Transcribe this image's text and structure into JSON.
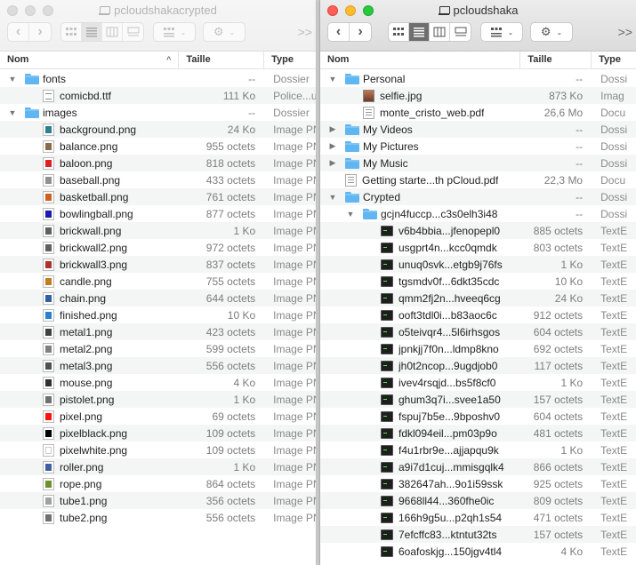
{
  "left_window": {
    "title": "pcloudshakacrypted",
    "columns": {
      "name": "Nom",
      "size": "Taille",
      "type": "Type"
    },
    "rows": [
      {
        "indent": 0,
        "disc": "▼",
        "kind": "folder",
        "name": "fonts",
        "size": "--",
        "type": "Dossier"
      },
      {
        "indent": 1,
        "disc": "",
        "kind": "ttf",
        "name": "comicbd.ttf",
        "size": "111 Ko",
        "type": "Police...u"
      },
      {
        "indent": 0,
        "disc": "▼",
        "kind": "folder",
        "name": "images",
        "size": "--",
        "type": "Dossier"
      },
      {
        "indent": 1,
        "disc": "",
        "kind": "png",
        "color": "#2e7f8f",
        "name": "background.png",
        "size": "24 Ko",
        "type": "Image PN"
      },
      {
        "indent": 1,
        "disc": "",
        "kind": "png",
        "color": "#8a6a4a",
        "name": "balance.png",
        "size": "955 octets",
        "type": "Image PN"
      },
      {
        "indent": 1,
        "disc": "",
        "kind": "png",
        "color": "#e02020",
        "name": "baloon.png",
        "size": "818 octets",
        "type": "Image PN"
      },
      {
        "indent": 1,
        "disc": "",
        "kind": "png",
        "color": "#909090",
        "name": "baseball.png",
        "size": "433 octets",
        "type": "Image PN"
      },
      {
        "indent": 1,
        "disc": "",
        "kind": "png",
        "color": "#d06020",
        "name": "basketball.png",
        "size": "761 octets",
        "type": "Image PN"
      },
      {
        "indent": 1,
        "disc": "",
        "kind": "png",
        "color": "#1a1ab0",
        "name": "bowlingball.png",
        "size": "877 octets",
        "type": "Image PN"
      },
      {
        "indent": 1,
        "disc": "",
        "kind": "png",
        "color": "#606060",
        "name": "brickwall.png",
        "size": "1 Ko",
        "type": "Image PN"
      },
      {
        "indent": 1,
        "disc": "",
        "kind": "png",
        "color": "#606060",
        "name": "brickwall2.png",
        "size": "972 octets",
        "type": "Image PN"
      },
      {
        "indent": 1,
        "disc": "",
        "kind": "png",
        "color": "#b03030",
        "name": "brickwall3.png",
        "size": "837 octets",
        "type": "Image PN"
      },
      {
        "indent": 1,
        "disc": "",
        "kind": "png",
        "color": "#c08020",
        "name": "candle.png",
        "size": "755 octets",
        "type": "Image PN"
      },
      {
        "indent": 1,
        "disc": "",
        "kind": "png",
        "color": "#3060a0",
        "name": "chain.png",
        "size": "644 octets",
        "type": "Image PN"
      },
      {
        "indent": 1,
        "disc": "",
        "kind": "png",
        "color": "#2a80d0",
        "name": "finished.png",
        "size": "10 Ko",
        "type": "Image PN"
      },
      {
        "indent": 1,
        "disc": "",
        "kind": "png",
        "color": "#404040",
        "name": "metal1.png",
        "size": "423 octets",
        "type": "Image PN"
      },
      {
        "indent": 1,
        "disc": "",
        "kind": "png",
        "color": "#808080",
        "name": "metal2.png",
        "size": "599 octets",
        "type": "Image PN"
      },
      {
        "indent": 1,
        "disc": "",
        "kind": "png",
        "color": "#505050",
        "name": "metal3.png",
        "size": "556 octets",
        "type": "Image PN"
      },
      {
        "indent": 1,
        "disc": "",
        "kind": "png",
        "color": "#303030",
        "name": "mouse.png",
        "size": "4 Ko",
        "type": "Image PN"
      },
      {
        "indent": 1,
        "disc": "",
        "kind": "png",
        "color": "#707070",
        "name": "pistolet.png",
        "size": "1 Ko",
        "type": "Image PN"
      },
      {
        "indent": 1,
        "disc": "",
        "kind": "png",
        "color": "#ff1010",
        "name": "pixel.png",
        "size": "69 octets",
        "type": "Image PN"
      },
      {
        "indent": 1,
        "disc": "",
        "kind": "png",
        "color": "#000000",
        "name": "pixelblack.png",
        "size": "109 octets",
        "type": "Image PN"
      },
      {
        "indent": 1,
        "disc": "",
        "kind": "png",
        "color": "#ffffff",
        "name": "pixelwhite.png",
        "size": "109 octets",
        "type": "Image PN"
      },
      {
        "indent": 1,
        "disc": "",
        "kind": "png",
        "color": "#4060a0",
        "name": "roller.png",
        "size": "1 Ko",
        "type": "Image PN"
      },
      {
        "indent": 1,
        "disc": "",
        "kind": "png",
        "color": "#709030",
        "name": "rope.png",
        "size": "864 octets",
        "type": "Image PN"
      },
      {
        "indent": 1,
        "disc": "",
        "kind": "png",
        "color": "#a0a0a0",
        "name": "tube1.png",
        "size": "356 octets",
        "type": "Image PN"
      },
      {
        "indent": 1,
        "disc": "",
        "kind": "png",
        "color": "#707070",
        "name": "tube2.png",
        "size": "556 octets",
        "type": "Image PN"
      }
    ]
  },
  "right_window": {
    "title": "pcloudshaka",
    "columns": {
      "name": "Nom",
      "size": "Taille",
      "type": "Type"
    },
    "rows": [
      {
        "indent": 0,
        "disc": "▼",
        "kind": "folder",
        "name": "Personal",
        "size": "--",
        "type": "Dossi"
      },
      {
        "indent": 1,
        "disc": "",
        "kind": "jpg",
        "name": "selfie.jpg",
        "size": "873 Ko",
        "type": "Imag"
      },
      {
        "indent": 1,
        "disc": "",
        "kind": "pdf",
        "name": "monte_cristo_web.pdf",
        "size": "26,6 Mo",
        "type": "Docu"
      },
      {
        "indent": 0,
        "disc": "▶",
        "kind": "folder",
        "name": "My Videos",
        "size": "--",
        "type": "Dossi"
      },
      {
        "indent": 0,
        "disc": "▶",
        "kind": "folder",
        "name": "My Pictures",
        "size": "--",
        "type": "Dossi"
      },
      {
        "indent": 0,
        "disc": "▶",
        "kind": "folder",
        "name": "My Music",
        "size": "--",
        "type": "Dossi"
      },
      {
        "indent": 0,
        "disc": "",
        "kind": "pdf",
        "name": "Getting starte...th pCloud.pdf",
        "size": "22,3 Mo",
        "type": "Docu"
      },
      {
        "indent": 0,
        "disc": "▼",
        "kind": "folder",
        "name": "Crypted",
        "size": "--",
        "type": "Dossi"
      },
      {
        "indent": 1,
        "disc": "▼",
        "kind": "folder",
        "name": "gcjn4fuccp...c3s0elh3i48",
        "size": "--",
        "type": "Dossi"
      },
      {
        "indent": 2,
        "disc": "",
        "kind": "term",
        "name": "v6b4bbia...jfenopepl0",
        "size": "885 octets",
        "type": "TextE"
      },
      {
        "indent": 2,
        "disc": "",
        "kind": "term",
        "name": "usgprt4n...kcc0qmdk",
        "size": "803 octets",
        "type": "TextE"
      },
      {
        "indent": 2,
        "disc": "",
        "kind": "term",
        "name": "unuq0svk...etgb9j76fs",
        "size": "1 Ko",
        "type": "TextE"
      },
      {
        "indent": 2,
        "disc": "",
        "kind": "term",
        "name": "tgsmdv0f...6dkt35cdc",
        "size": "10 Ko",
        "type": "TextE"
      },
      {
        "indent": 2,
        "disc": "",
        "kind": "term",
        "name": "qmm2fj2n...hveeq6cg",
        "size": "24 Ko",
        "type": "TextE"
      },
      {
        "indent": 2,
        "disc": "",
        "kind": "term",
        "name": "ooft3tdl0i...b83aoc6c",
        "size": "912 octets",
        "type": "TextE"
      },
      {
        "indent": 2,
        "disc": "",
        "kind": "term",
        "name": "o5teivqr4...5l6irhsgos",
        "size": "604 octets",
        "type": "TextE"
      },
      {
        "indent": 2,
        "disc": "",
        "kind": "term",
        "name": "jpnkjj7f0n...ldmp8kno",
        "size": "692 octets",
        "type": "TextE"
      },
      {
        "indent": 2,
        "disc": "",
        "kind": "term",
        "name": "jh0t2ncop...9ugdjob0",
        "size": "117 octets",
        "type": "TextE"
      },
      {
        "indent": 2,
        "disc": "",
        "kind": "term",
        "name": "ivev4rsqjd...bs5f8cf0",
        "size": "1 Ko",
        "type": "TextE"
      },
      {
        "indent": 2,
        "disc": "",
        "kind": "term",
        "name": "ghum3q7i...svee1a50",
        "size": "157 octets",
        "type": "TextE"
      },
      {
        "indent": 2,
        "disc": "",
        "kind": "term",
        "name": "fspuj7b5e...9bposhv0",
        "size": "604 octets",
        "type": "TextE"
      },
      {
        "indent": 2,
        "disc": "",
        "kind": "term",
        "name": "fdkl094eil...pm03p9o",
        "size": "481 octets",
        "type": "TextE"
      },
      {
        "indent": 2,
        "disc": "",
        "kind": "term",
        "name": "f4u1rbr9e...ajjapqu9k",
        "size": "1 Ko",
        "type": "TextE"
      },
      {
        "indent": 2,
        "disc": "",
        "kind": "term",
        "name": "a9i7d1cuj...mmisgqlk4",
        "size": "866 octets",
        "type": "TextE"
      },
      {
        "indent": 2,
        "disc": "",
        "kind": "term",
        "name": "382647ah...9o1i59ssk",
        "size": "925 octets",
        "type": "TextE"
      },
      {
        "indent": 2,
        "disc": "",
        "kind": "term",
        "name": "9668ll44...360fhe0ic",
        "size": "809 octets",
        "type": "TextE"
      },
      {
        "indent": 2,
        "disc": "",
        "kind": "term",
        "name": "166h9g5u...p2qh1s54",
        "size": "471 octets",
        "type": "TextE"
      },
      {
        "indent": 2,
        "disc": "",
        "kind": "term",
        "name": "7efcffc83...ktntut32ts",
        "size": "157 octets",
        "type": "TextE"
      },
      {
        "indent": 2,
        "disc": "",
        "kind": "term",
        "name": "6oafoskjg...150jgv4tl4",
        "size": "4 Ko",
        "type": "TextE"
      }
    ]
  },
  "toolbar": {
    "back_icon": "chevron-left-icon",
    "forward_icon": "chevron-right-icon",
    "view_icons": [
      "icon-view-icon",
      "list-view-icon",
      "column-view-icon",
      "gallery-view-icon"
    ],
    "group_icon": "group-by-icon",
    "action_icon": "gear-icon",
    "more_label": ">>"
  }
}
